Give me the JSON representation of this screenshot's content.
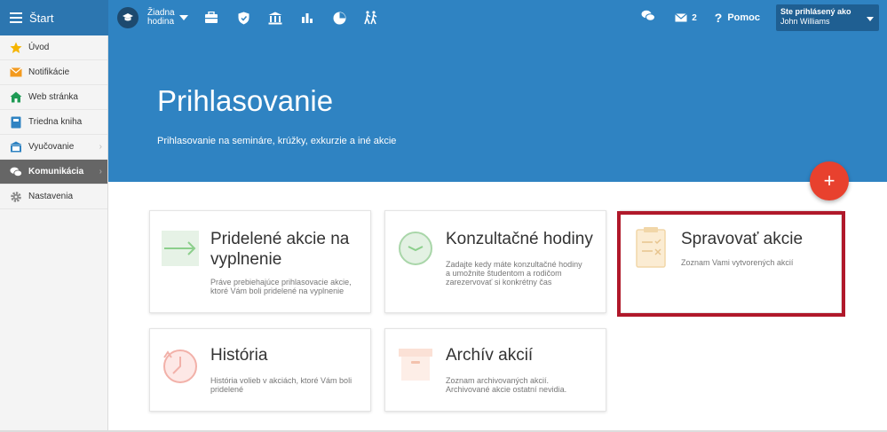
{
  "topbar": {
    "start_label": "Štart",
    "hodina_line1": "Žiadna",
    "hodina_line2": "hodina",
    "mail_count": "2",
    "help_label": "Pomoc",
    "user_label": "Ste prihlásený ako",
    "user_name": "John Williams"
  },
  "sidebar": {
    "items": [
      {
        "label": "Úvod",
        "icon": "star-icon"
      },
      {
        "label": "Notifikácie",
        "icon": "envelope-icon"
      },
      {
        "label": "Web stránka",
        "icon": "home-icon"
      },
      {
        "label": "Triedna kniha",
        "icon": "book-icon"
      },
      {
        "label": "Vyučovanie",
        "icon": "classroom-icon"
      },
      {
        "label": "Komunikácia",
        "icon": "chat-icon"
      },
      {
        "label": "Nastavenia",
        "icon": "gear-icon"
      }
    ]
  },
  "hero": {
    "title": "Prihlasovanie",
    "subtitle": "Prihlasovanie na semináre, krúžky, exkurzie a iné akcie"
  },
  "fab_label": "+",
  "cards": [
    {
      "title_line1": "Pridelené akcie na",
      "title_line2": "vyplnenie",
      "desc_line1": "Práve prebiehajúce prihlasovacie akcie,",
      "desc_line2": "ktoré Vám boli pridelené na vyplnenie",
      "desc_line3": ""
    },
    {
      "title_line1": "Konzultačné hodiny",
      "title_line2": "",
      "desc_line1": "Zadajte kedy máte konzultačné hodiny",
      "desc_line2": "a umožnite študentom a rodičom",
      "desc_line3": "zarezervovať si konkrétny čas"
    },
    {
      "title_line1": "Spravovať akcie",
      "title_line2": "",
      "desc_line1": "Zoznam Vami vytvorených akcií",
      "desc_line2": "",
      "desc_line3": ""
    },
    {
      "title_line1": "História",
      "title_line2": "",
      "desc_line1": "História volieb v akciách, ktoré Vám boli",
      "desc_line2": "pridelené",
      "desc_line3": ""
    },
    {
      "title_line1": "Archív akcií",
      "title_line2": "",
      "desc_line1": "Zoznam archivovaných akcií.",
      "desc_line2": "Archivované akcie ostatní nevidia.",
      "desc_line3": ""
    }
  ],
  "colors": {
    "topbar": "#2f83c2",
    "sidebar_active": "#666666",
    "fab": "#e8412e",
    "highlight": "#b0182a"
  }
}
